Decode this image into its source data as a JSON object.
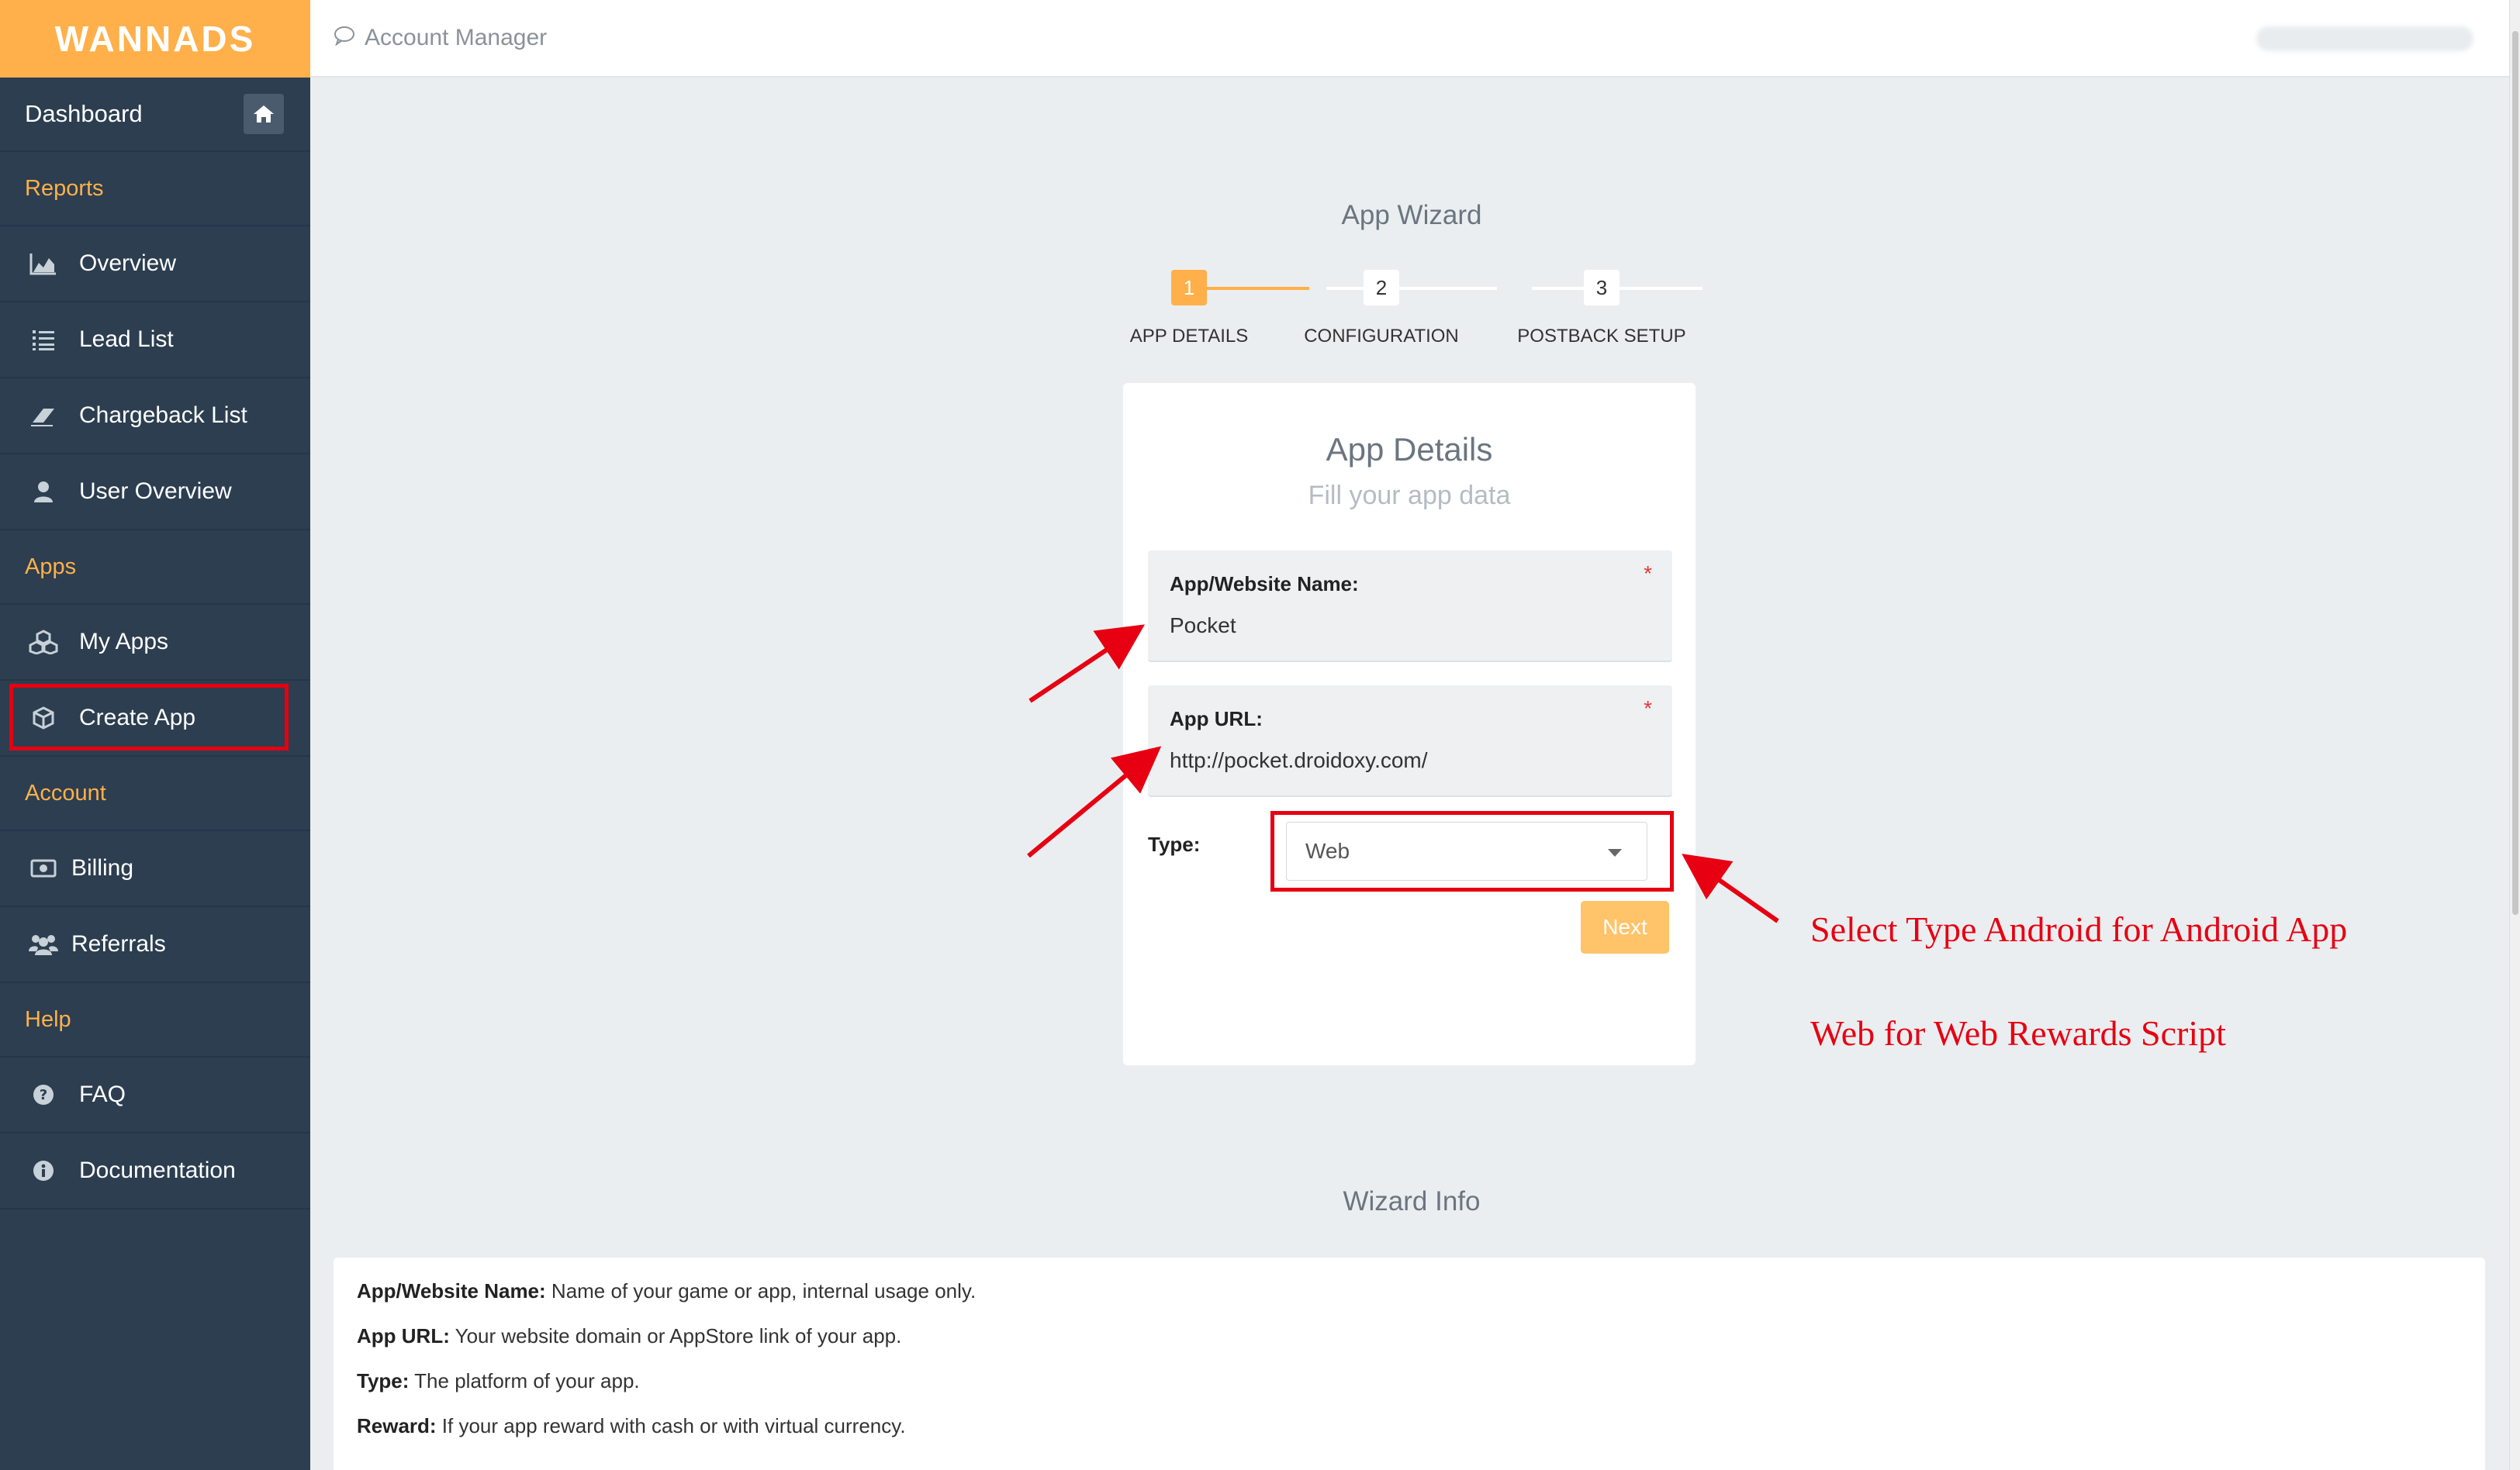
{
  "brand": "WANNADS",
  "topbar": {
    "crumb": "Account Manager"
  },
  "sidebar": {
    "dashboard": "Dashboard",
    "sections": {
      "reports": "Reports",
      "apps": "Apps",
      "account": "Account",
      "help": "Help"
    },
    "items": {
      "overview": "Overview",
      "lead_list": "Lead List",
      "chargeback_list": "Chargeback List",
      "user_overview": "User Overview",
      "my_apps": "My Apps",
      "create_app": "Create App",
      "billing": "Billing",
      "referrals": "Referrals",
      "faq": "FAQ",
      "documentation": "Documentation"
    }
  },
  "wizard": {
    "title": "App Wizard",
    "steps": [
      {
        "num": "1",
        "label": "APP DETAILS"
      },
      {
        "num": "2",
        "label": "CONFIGURATION"
      },
      {
        "num": "3",
        "label": "POSTBACK SETUP"
      }
    ],
    "card": {
      "title": "App Details",
      "subtitle": "Fill your app data",
      "name_label": "App/Website Name:",
      "name_value": "Pocket",
      "url_label": "App URL:",
      "url_value": "http://pocket.droidoxy.com/",
      "required_mark": "*",
      "type_label": "Type:",
      "type_value": "Web",
      "next_label": "Next"
    }
  },
  "annotations": {
    "line1": "Select Type Android for Android App",
    "line2": "Web for Web Rewards Script"
  },
  "info": {
    "title": "Wizard Info",
    "lines": [
      {
        "term": "App/Website Name:",
        "desc": " Name of your game or app, internal usage only."
      },
      {
        "term": "App URL:",
        "desc": " Your website domain or AppStore link of your app."
      },
      {
        "term": "Type:",
        "desc": " The platform of your app."
      },
      {
        "term": "Reward:",
        "desc": " If your app reward with cash or with virtual currency."
      }
    ]
  },
  "colors": {
    "accent": "#ffb04a",
    "sidebar": "#2c3e50",
    "annotation": "#e60012"
  }
}
